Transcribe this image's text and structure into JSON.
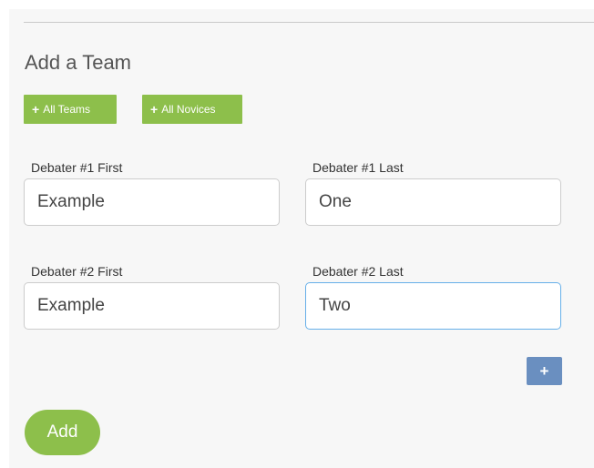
{
  "form": {
    "title": "Add a Team",
    "quick_buttons": {
      "all_teams_label": "All Teams",
      "all_novices_label": "All Novices"
    },
    "debaters": [
      {
        "first_label": "Debater #1 First",
        "first_value": "Example",
        "last_label": "Debater #1 Last",
        "last_value": "One"
      },
      {
        "first_label": "Debater #2 First",
        "first_value": "Example",
        "last_label": "Debater #2 Last",
        "last_value": "Two"
      }
    ],
    "add_debater_icon": "+",
    "submit_label": "Add"
  },
  "colors": {
    "green_button": "#8dbf4b",
    "blue_button": "#6a8fc0",
    "focus_border": "#66afe9"
  },
  "icons": {
    "quick_button_icon": "plus-icon"
  }
}
